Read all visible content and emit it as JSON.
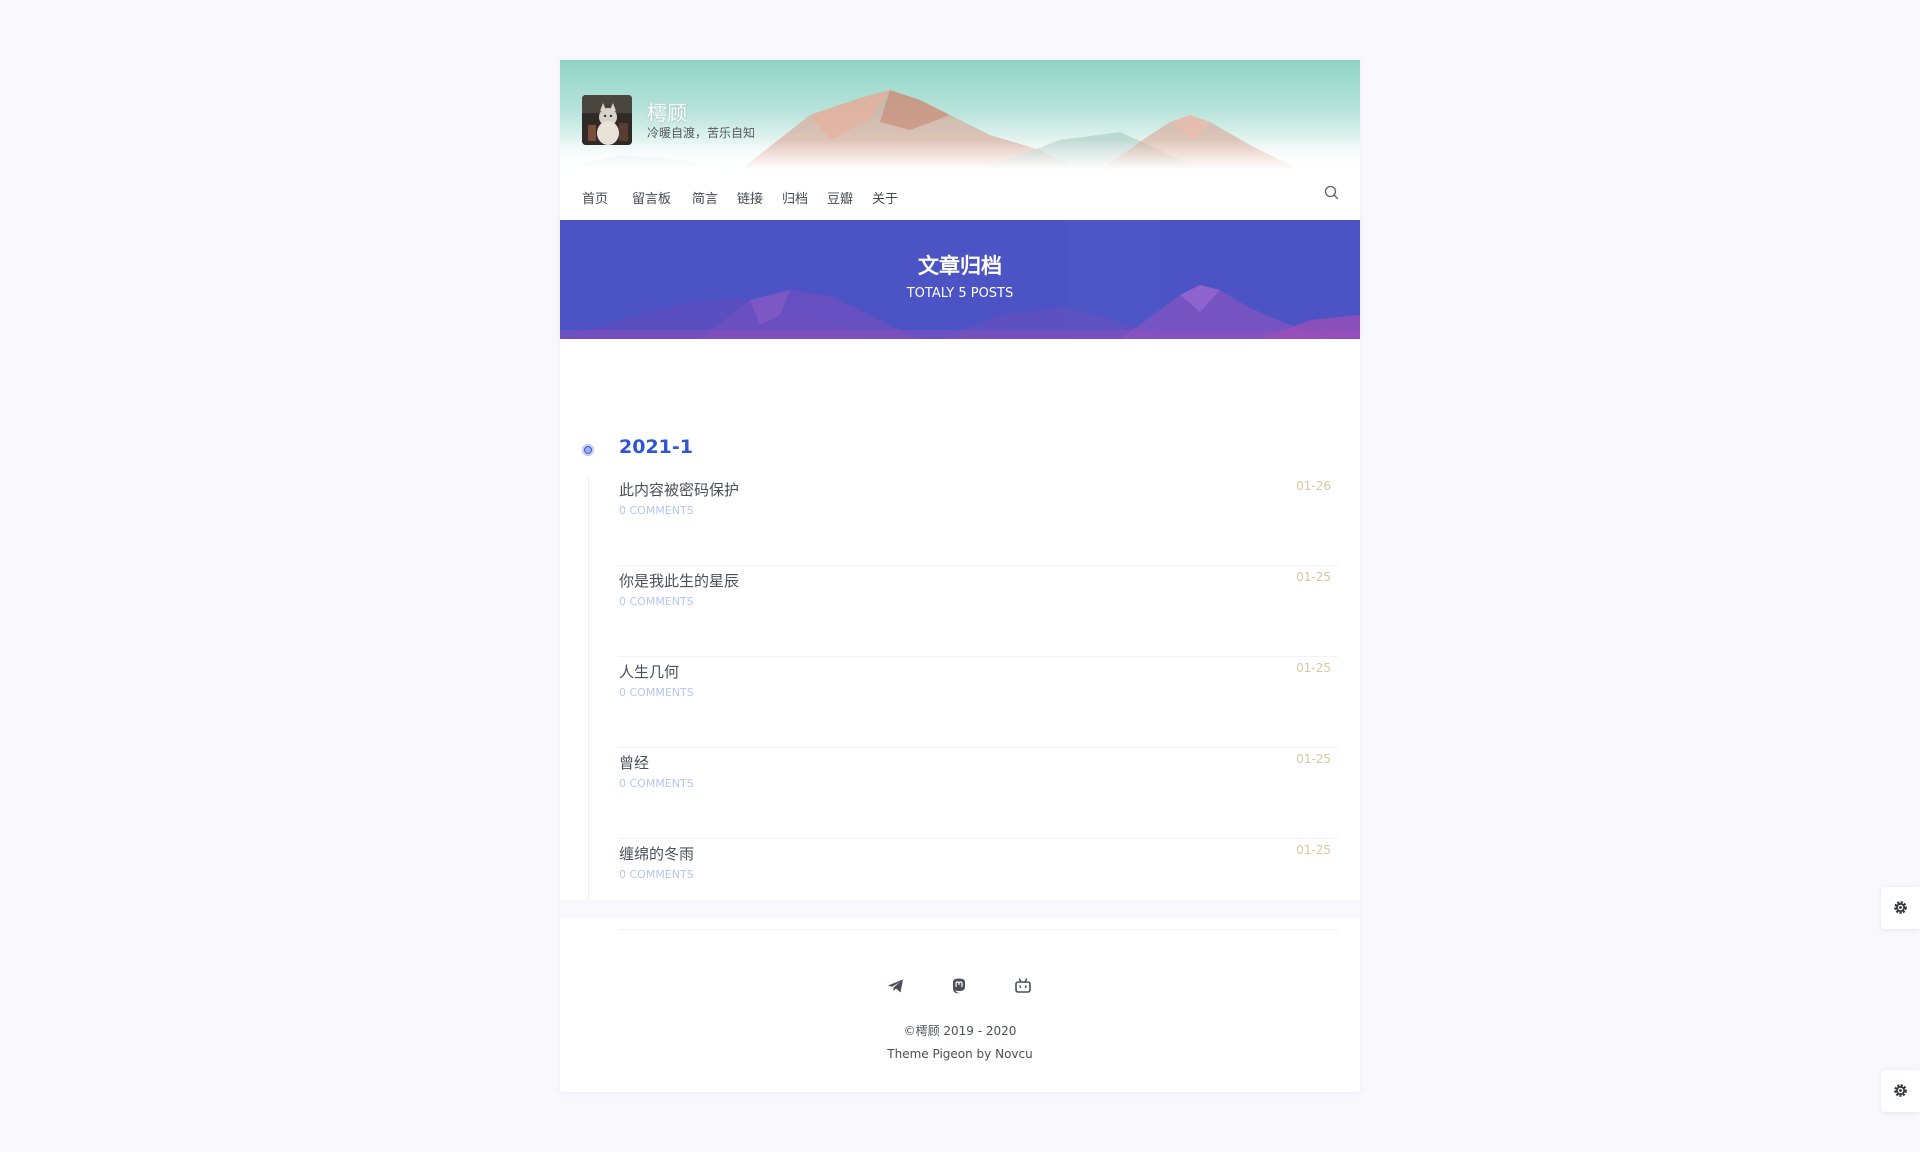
{
  "site": {
    "title": "樗顾",
    "subtitle": "冷暖自渡，苦乐自知",
    "colors": {
      "accent": "#2f55d4",
      "banner": "#4b52c3",
      "comments": "#b6c6ee",
      "date": "#d9c7a0"
    }
  },
  "nav": {
    "items": [
      {
        "label": "首页"
      },
      {
        "label": "留言板"
      },
      {
        "label": "简言"
      },
      {
        "label": "链接"
      },
      {
        "label": "归档"
      },
      {
        "label": "豆瓣"
      },
      {
        "label": "关于"
      }
    ],
    "search_icon": "search-icon"
  },
  "banner": {
    "title": "文章归档",
    "subtitle": "TOTALY 5 POSTS"
  },
  "archive": {
    "year": "2021-1",
    "posts": [
      {
        "title": "此内容被密码保护",
        "comments": "0 COMMENTS",
        "date": "01-26"
      },
      {
        "title": "你是我此生的星辰",
        "comments": "0 COMMENTS",
        "date": "01-25"
      },
      {
        "title": "人生几何",
        "comments": "0 COMMENTS",
        "date": "01-25"
      },
      {
        "title": "曾经",
        "comments": "0 COMMENTS",
        "date": "01-25"
      },
      {
        "title": "缠绵的冬雨",
        "comments": "0 COMMENTS",
        "date": "01-25"
      }
    ]
  },
  "footer": {
    "social_icons": [
      "telegram-icon",
      "mastodon-icon",
      "bilibili-icon"
    ],
    "copyright": "©樗顾 2019 - 2020",
    "theme_credit": "Theme Pigeon by Novcu"
  },
  "floating": {
    "icons": [
      "settings-icon",
      "settings-icon"
    ]
  }
}
